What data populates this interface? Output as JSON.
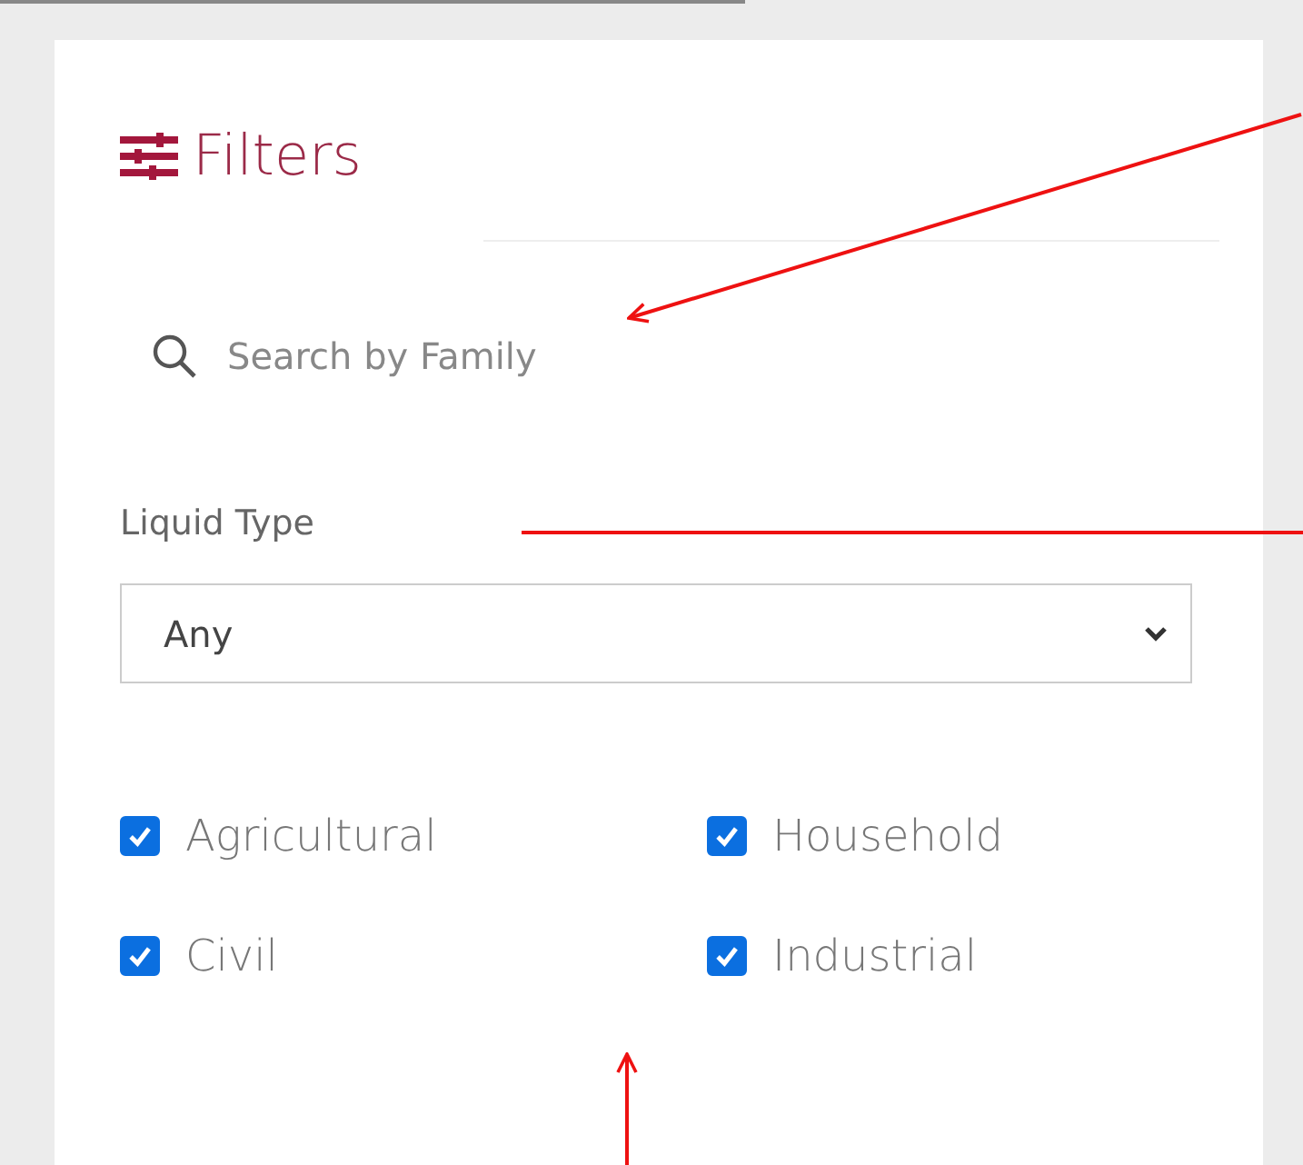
{
  "panel": {
    "title": "Filters"
  },
  "search": {
    "placeholder": "Search by Family"
  },
  "liquid_type": {
    "label": "Liquid Type",
    "value": "Any"
  },
  "categories": [
    {
      "label": "Agricultural",
      "checked": true
    },
    {
      "label": "Household",
      "checked": true
    },
    {
      "label": "Civil",
      "checked": true
    },
    {
      "label": "Industrial",
      "checked": true
    }
  ]
}
